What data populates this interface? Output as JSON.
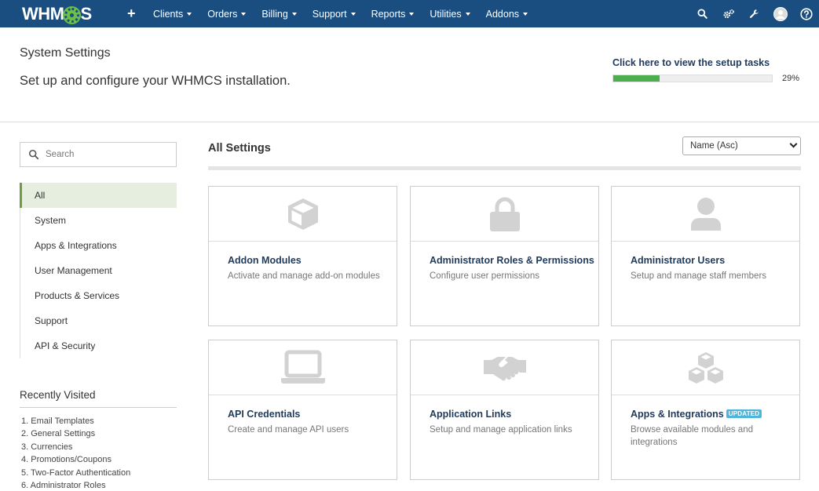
{
  "brand": {
    "logo_pre": "WHM",
    "logo_post": "S"
  },
  "nav": {
    "items": [
      {
        "label": "Clients"
      },
      {
        "label": "Orders"
      },
      {
        "label": "Billing"
      },
      {
        "label": "Support"
      },
      {
        "label": "Reports"
      },
      {
        "label": "Utilities"
      },
      {
        "label": "Addons"
      }
    ],
    "right_icons": [
      "search-icon",
      "cogs-icon",
      "wrench-icon",
      "avatar-icon",
      "help-icon"
    ]
  },
  "header": {
    "title": "System Settings",
    "subtitle": "Set up and configure your WHMCS installation.",
    "setup_link": "Click here to view the setup tasks",
    "progress_pct": 29,
    "progress_label": "29%",
    "accent_color": "#4cae4c"
  },
  "sidebar": {
    "search_placeholder": "Search",
    "categories": [
      {
        "label": "All",
        "active": true
      },
      {
        "label": "System"
      },
      {
        "label": "Apps & Integrations"
      },
      {
        "label": "User Management"
      },
      {
        "label": "Products & Services"
      },
      {
        "label": "Support"
      },
      {
        "label": "API & Security"
      }
    ],
    "recent_title": "Recently Visited",
    "recent": [
      "1. Email Templates",
      "2. General Settings",
      "3. Currencies",
      "4. Promotions/Coupons",
      "5. Two-Factor Authentication",
      "6. Administrator Roles"
    ]
  },
  "main": {
    "section_title": "All Settings",
    "sort_value": "Name (Asc)",
    "cards": [
      {
        "title": "Addon Modules",
        "desc": "Activate and manage add-on modules",
        "icon": "cube-icon"
      },
      {
        "title": "Administrator Roles & Permissions",
        "desc": "Configure user permissions",
        "icon": "lock-icon"
      },
      {
        "title": "Administrator Users",
        "desc": "Setup and manage staff members",
        "icon": "user-icon"
      },
      {
        "title": "API Credentials",
        "desc": "Create and manage API users",
        "icon": "laptop-icon"
      },
      {
        "title": "Application Links",
        "desc": "Setup and manage application links",
        "icon": "handshake-icon"
      },
      {
        "title": "Apps & Integrations",
        "desc": "Browse available modules and integrations",
        "icon": "cubes-icon",
        "badge": "UPDATED"
      }
    ]
  }
}
